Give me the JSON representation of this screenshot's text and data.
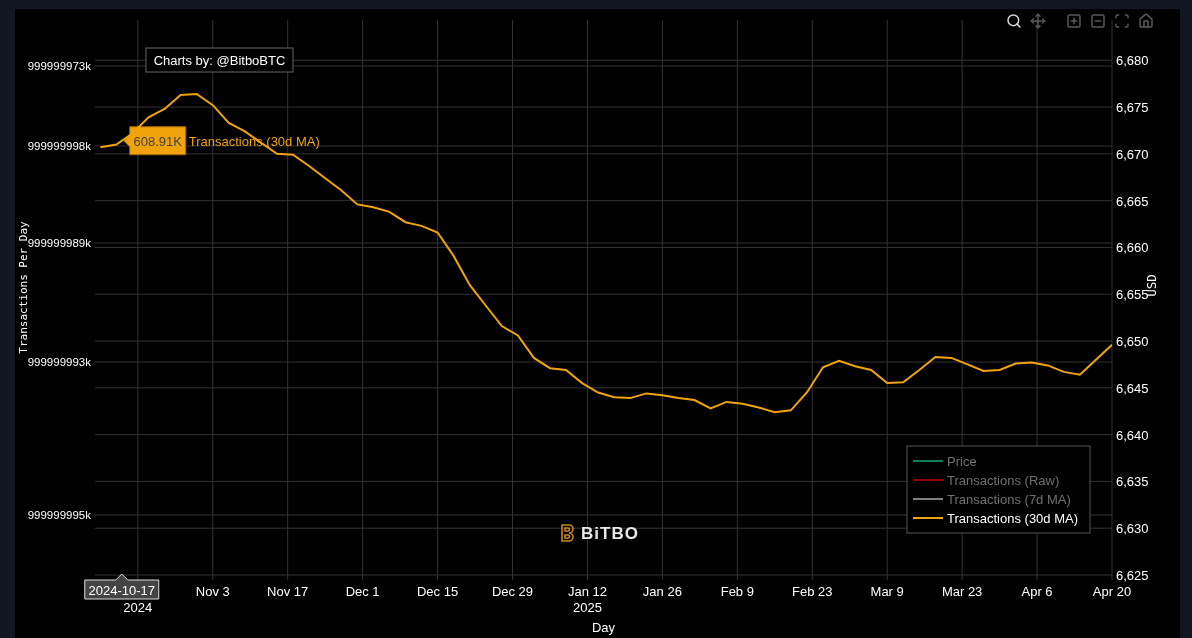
{
  "modebar": [
    {
      "kind": "zoom",
      "selected": true
    },
    {
      "kind": "pan",
      "selected": false
    },
    {
      "kind": "zoom-in",
      "selected": false
    },
    {
      "kind": "zoom-out",
      "selected": false
    },
    {
      "kind": "autoscale",
      "selected": false
    },
    {
      "kind": "home",
      "selected": false
    }
  ],
  "left_axis": {
    "title": "Transactions Per Day",
    "labels": [
      "999999973k",
      "999999998k",
      "999999989k",
      "999999993k",
      "999999995k"
    ]
  },
  "chart_data": {
    "type": "line",
    "xlabel": "Day",
    "ylabel": "USD",
    "grid": true,
    "xlim": [
      "2024-10-12",
      "2025-04-20"
    ],
    "ylim": [
      6625,
      6684.3
    ],
    "x": [
      "2024-10-13",
      "2024-10-16",
      "2024-10-19",
      "2024-10-22",
      "2024-10-25",
      "2024-10-28",
      "2024-10-31",
      "2024-11-03",
      "2024-11-06",
      "2024-11-09",
      "2024-11-12",
      "2024-11-15",
      "2024-11-18",
      "2024-11-21",
      "2024-11-24",
      "2024-11-27",
      "2024-11-30",
      "2024-12-03",
      "2024-12-06",
      "2024-12-09",
      "2024-12-12",
      "2024-12-15",
      "2024-12-18",
      "2024-12-21",
      "2024-12-24",
      "2024-12-27",
      "2024-12-30",
      "2025-01-02",
      "2025-01-05",
      "2025-01-08",
      "2025-01-11",
      "2025-01-14",
      "2025-01-17",
      "2025-01-20",
      "2025-01-23",
      "2025-01-26",
      "2025-01-29",
      "2025-02-01",
      "2025-02-04",
      "2025-02-07",
      "2025-02-10",
      "2025-02-13",
      "2025-02-16",
      "2025-02-19",
      "2025-02-22",
      "2025-02-25",
      "2025-02-28",
      "2025-03-03",
      "2025-03-06",
      "2025-03-09",
      "2025-03-12",
      "2025-03-15",
      "2025-03-18",
      "2025-03-21",
      "2025-03-24",
      "2025-03-27",
      "2025-03-30",
      "2025-04-02",
      "2025-04-05",
      "2025-04-08",
      "2025-04-11",
      "2025-04-14",
      "2025-04-17",
      "2025-04-20"
    ],
    "series": [
      {
        "name": "Transactions (30d MA)",
        "color": "#f0a30a",
        "values": [
          6670.7,
          6671.0,
          6672.2,
          6673.9,
          6674.8,
          6676.3,
          6676.4,
          6675.2,
          6673.3,
          6672.4,
          6671.2,
          6670.0,
          6669.9,
          6668.7,
          6667.4,
          6666.1,
          6664.6,
          6664.3,
          6663.8,
          6662.7,
          6662.3,
          6661.6,
          6659.1,
          6656.0,
          6653.8,
          6651.6,
          6650.6,
          6648.2,
          6647.1,
          6646.9,
          6645.5,
          6644.5,
          6644.0,
          6643.9,
          6644.4,
          6644.2,
          6643.9,
          6643.7,
          6642.8,
          6643.5,
          6643.3,
          6642.9,
          6642.4,
          6642.6,
          6644.5,
          6647.2,
          6647.9,
          6647.3,
          6646.9,
          6645.5,
          6645.6,
          6646.9,
          6648.3,
          6648.2,
          6647.5,
          6646.8,
          6646.9,
          6647.6,
          6647.7,
          6647.4,
          6646.7,
          6646.4,
          6648.0,
          6649.6
        ]
      }
    ],
    "xticks": [
      {
        "value": "2024-11-03",
        "label": "Nov 3"
      },
      {
        "value": "2024-11-17",
        "label": "Nov 17"
      },
      {
        "value": "2024-12-01",
        "label": "Dec 1"
      },
      {
        "value": "2024-12-15",
        "label": "Dec 15"
      },
      {
        "value": "2024-12-29",
        "label": "Dec 29"
      },
      {
        "value": "2025-01-12",
        "label": "Jan 12"
      },
      {
        "value": "2025-01-26",
        "label": "Jan 26"
      },
      {
        "value": "2025-02-09",
        "label": "Feb 9"
      },
      {
        "value": "2025-02-23",
        "label": "Feb 23"
      },
      {
        "value": "2025-03-09",
        "label": "Mar 9"
      },
      {
        "value": "2025-03-23",
        "label": "Mar 23"
      },
      {
        "value": "2025-04-06",
        "label": "Apr 6"
      },
      {
        "value": "2025-04-20",
        "label": "Apr 20"
      }
    ],
    "yticks": [
      {
        "value": 6625,
        "label": "6,625"
      },
      {
        "value": 6630,
        "label": "6,630"
      },
      {
        "value": 6635,
        "label": "6,635"
      },
      {
        "value": 6640,
        "label": "6,640"
      },
      {
        "value": 6645,
        "label": "6,645"
      },
      {
        "value": 6650,
        "label": "6,650"
      },
      {
        "value": 6655,
        "label": "6,655"
      },
      {
        "value": 6660,
        "label": "6,660"
      },
      {
        "value": 6665,
        "label": "6,665"
      },
      {
        "value": 6670,
        "label": "6,670"
      },
      {
        "value": 6675,
        "label": "6,675"
      },
      {
        "value": 6680,
        "label": "6,680"
      }
    ],
    "annotations": [
      "Charts by: @BitboBTC"
    ]
  },
  "year_labels": [
    "2024",
    "2025"
  ],
  "hover": {
    "value": "608.91K",
    "date": "2024-10-17"
  },
  "logo": "BiTBO",
  "legend": [
    {
      "label": "Price",
      "color": "#0f7d57",
      "visible": false
    },
    {
      "label": "Transactions (Raw)",
      "color": "#8b0000",
      "visible": false
    },
    {
      "label": "Transactions (7d MA)",
      "color": "#808080",
      "visible": false
    },
    {
      "label": "Transactions (30d MA)",
      "color": "#f0a30a",
      "visible": true
    }
  ]
}
